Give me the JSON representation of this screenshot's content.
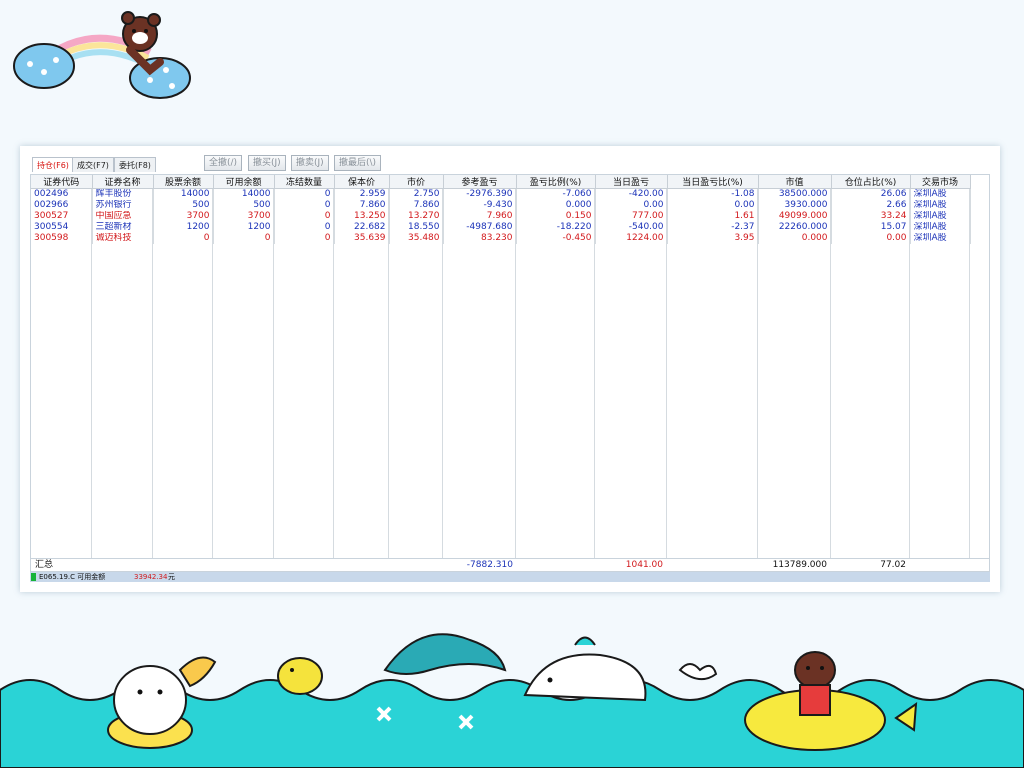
{
  "tabs": [
    {
      "label": "持仓(F6)"
    },
    {
      "label": "成交(F7)"
    },
    {
      "label": "委托(F8)"
    }
  ],
  "toolbar": {
    "cancel_all": "全撤(/)",
    "cancel_buy": "撤买(J)",
    "cancel_sell": "撤卖(J)",
    "cancel_last": "撤最后(\\)"
  },
  "columns": [
    "证券代码",
    "证券名称",
    "股票余额",
    "可用余额",
    "冻结数量",
    "保本价",
    "市价",
    "参考盈亏",
    "盈亏比例(%)",
    "当日盈亏",
    "当日盈亏比(%)",
    "市值",
    "仓位占比(%)",
    "交易市场"
  ],
  "rows": [
    {
      "code": "002496",
      "name": "辉丰股份",
      "balance": "14000",
      "available": "14000",
      "frozen": "0",
      "breakeven": "2.959",
      "price": "2.750",
      "pnl": "-2976.390",
      "pnl_pct": "-7.060",
      "day_pnl": "-420.00",
      "day_pnl_pct": "-1.08",
      "value": "38500.000",
      "position_pct": "26.06",
      "market": "深圳A股",
      "color": "blue"
    },
    {
      "code": "002966",
      "name": "苏州银行",
      "balance": "500",
      "available": "500",
      "frozen": "0",
      "breakeven": "7.860",
      "price": "7.860",
      "pnl": "-9.430",
      "pnl_pct": "0.000",
      "day_pnl": "0.00",
      "day_pnl_pct": "0.00",
      "value": "3930.000",
      "position_pct": "2.66",
      "market": "深圳A股",
      "color": "blue"
    },
    {
      "code": "300527",
      "name": "中国应急",
      "balance": "3700",
      "available": "3700",
      "frozen": "0",
      "breakeven": "13.250",
      "price": "13.270",
      "pnl": "7.960",
      "pnl_pct": "0.150",
      "day_pnl": "777.00",
      "day_pnl_pct": "1.61",
      "value": "49099.000",
      "position_pct": "33.24",
      "market": "深圳A股",
      "color": "red"
    },
    {
      "code": "300554",
      "name": "三超新材",
      "balance": "1200",
      "available": "1200",
      "frozen": "0",
      "breakeven": "22.682",
      "price": "18.550",
      "pnl": "-4987.680",
      "pnl_pct": "-18.220",
      "day_pnl": "-540.00",
      "day_pnl_pct": "-2.37",
      "value": "22260.000",
      "position_pct": "15.07",
      "market": "深圳A股",
      "color": "blue"
    },
    {
      "code": "300598",
      "name": "诚迈科技",
      "balance": "0",
      "available": "0",
      "frozen": "0",
      "breakeven": "35.639",
      "price": "35.480",
      "pnl": "83.230",
      "pnl_pct": "-0.450",
      "day_pnl": "1224.00",
      "day_pnl_pct": "3.95",
      "value": "0.000",
      "position_pct": "0.00",
      "market": "深圳A股",
      "color": "red"
    }
  ],
  "summary": {
    "label": "汇总",
    "pnl": "-7882.310",
    "day_pnl": "1041.00",
    "value": "113789.000",
    "position_pct": "77.02"
  },
  "status": {
    "left_text": "E065.19.C 可用金额",
    "amount": "33942.34",
    "unit": "元"
  },
  "colors": {
    "positive": "#d2191c",
    "negative": "#1c33b8",
    "active_tab": "#d8140f",
    "sea": "#2ad3d6",
    "status_bar": "#c8d8ea"
  }
}
